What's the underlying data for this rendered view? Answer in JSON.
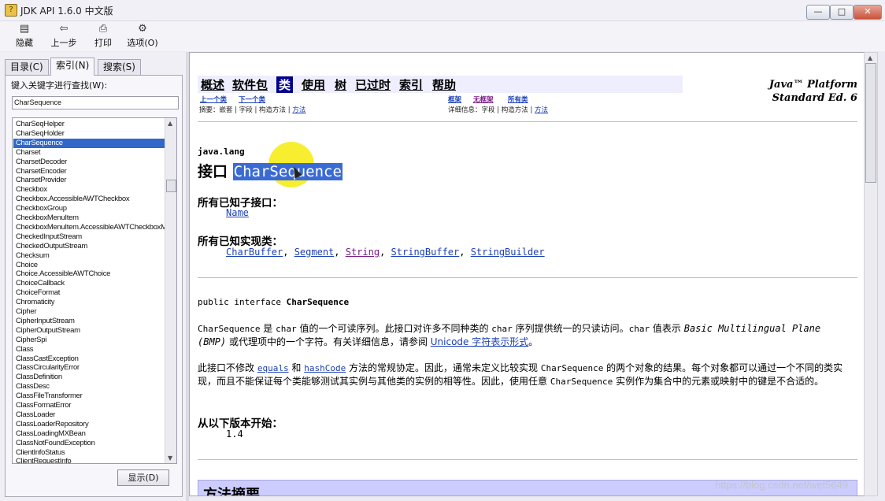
{
  "window": {
    "title": "JDK API 1.6.0 中文版",
    "minimize": "—",
    "maximize": "□",
    "close": "✕"
  },
  "toolbar": [
    {
      "label": "隐藏",
      "icon": "hide-icon",
      "glyph": "▤"
    },
    {
      "label": "上一步",
      "icon": "back-arrow-icon",
      "glyph": "⇦"
    },
    {
      "label": "打印",
      "icon": "printer-icon",
      "glyph": "⎙"
    },
    {
      "label": "选项(O)",
      "icon": "options-icon",
      "glyph": "⚙"
    }
  ],
  "leftpane": {
    "tabs": [
      "目录(C)",
      "索引(N)",
      "搜索(S)"
    ],
    "active_tab": "索引(N)",
    "keyword_label": "键入关键字进行查找(W):",
    "keyword_value": "CharSequence",
    "list_items": [
      "CharSeqHelper",
      "CharSeqHolder",
      "CharSequence",
      "Charset",
      "CharsetDecoder",
      "CharsetEncoder",
      "CharsetProvider",
      "Checkbox",
      "Checkbox.AccessibleAWTCheckbox",
      "CheckboxGroup",
      "CheckboxMenuItem",
      "CheckboxMenuItem.AccessibleAWTCheckboxM",
      "CheckedInputStream",
      "CheckedOutputStream",
      "Checksum",
      "Choice",
      "Choice.AccessibleAWTChoice",
      "ChoiceCallback",
      "ChoiceFormat",
      "Chromaticity",
      "Cipher",
      "CipherInputStream",
      "CipherOutputStream",
      "CipherSpi",
      "Class",
      "ClassCastException",
      "ClassCircularityError",
      "ClassDefinition",
      "ClassDesc",
      "ClassFileTransformer",
      "ClassFormatError",
      "ClassLoader",
      "ClassLoaderRepository",
      "ClassLoadingMXBean",
      "ClassNotFoundException",
      "ClientInfoStatus",
      "ClientRequestInfo"
    ],
    "selected_item": "CharSequence",
    "display_button": "显示(D)"
  },
  "doc": {
    "nav": [
      "概述",
      "软件包",
      "类",
      "使用",
      "树",
      "已过时",
      "索引",
      "帮助"
    ],
    "nav_active": "类",
    "platform_line1": "Java™ Platform",
    "platform_line2": "Standard Ed. 6",
    "prev_class": "上一个类",
    "next_class": "下一个类",
    "frames": "框架",
    "no_frames": "无框架",
    "all_classes": "所有类",
    "summary_prefix": "摘要：嵌套 | 字段 | 构造方法 | ",
    "summary_link": "方法",
    "detail_prefix": "详细信息：字段 | 构造方法 | ",
    "detail_link": "方法",
    "package": "java.lang",
    "interface_prefix": "接口",
    "interface_name": "CharSequence",
    "known_subinterfaces_title": "所有已知子接口：",
    "known_subinterfaces": [
      "Name"
    ],
    "known_impl_title": "所有已知实现类：",
    "known_impl": [
      "CharBuffer",
      "Segment",
      "String",
      "StringBuffer",
      "StringBuilder"
    ],
    "declaration_prefix": "public interface ",
    "declaration_name": "CharSequence",
    "para1_a": "CharSequence",
    "para1_b": " 是 ",
    "para1_c": "char",
    "para1_d": " 值的一个可读序列。此接口对许多不同种类的 ",
    "para1_e": "char",
    "para1_f": " 序列提供统一的只读访问。",
    "para1_g": "char",
    "para1_h": " 值表示 ",
    "para1_i": "Basic Multilingual Plane (BMP)",
    "para1_j": " 或代理项中的一个字符。有关详细信息，请参阅 ",
    "para1_link": "Unicode 字符表示形式",
    "para1_end": "。",
    "para2_a": "此接口不修改 ",
    "para2_equals": "equals",
    "para2_b": " 和 ",
    "para2_hashcode": "hashCode",
    "para2_c": " 方法的常规协定。因此，通常未定义比较实现 ",
    "para2_d": "CharSequence",
    "para2_e": " 的两个对象的结果。每个对象都可以通过一个不同的类实现，而且不能保证每个类能够测试其实例与其他类的实例的相等性。因此，使用任意 ",
    "para2_f": "CharSequence",
    "para2_g": " 实例作为集合中的元素或映射中的键是不合适的。",
    "since_title": "从以下版本开始：",
    "since_value": "1.4",
    "method_summary": "方法摘要"
  },
  "watermark": "https://blog.csdn.net/wet5649"
}
